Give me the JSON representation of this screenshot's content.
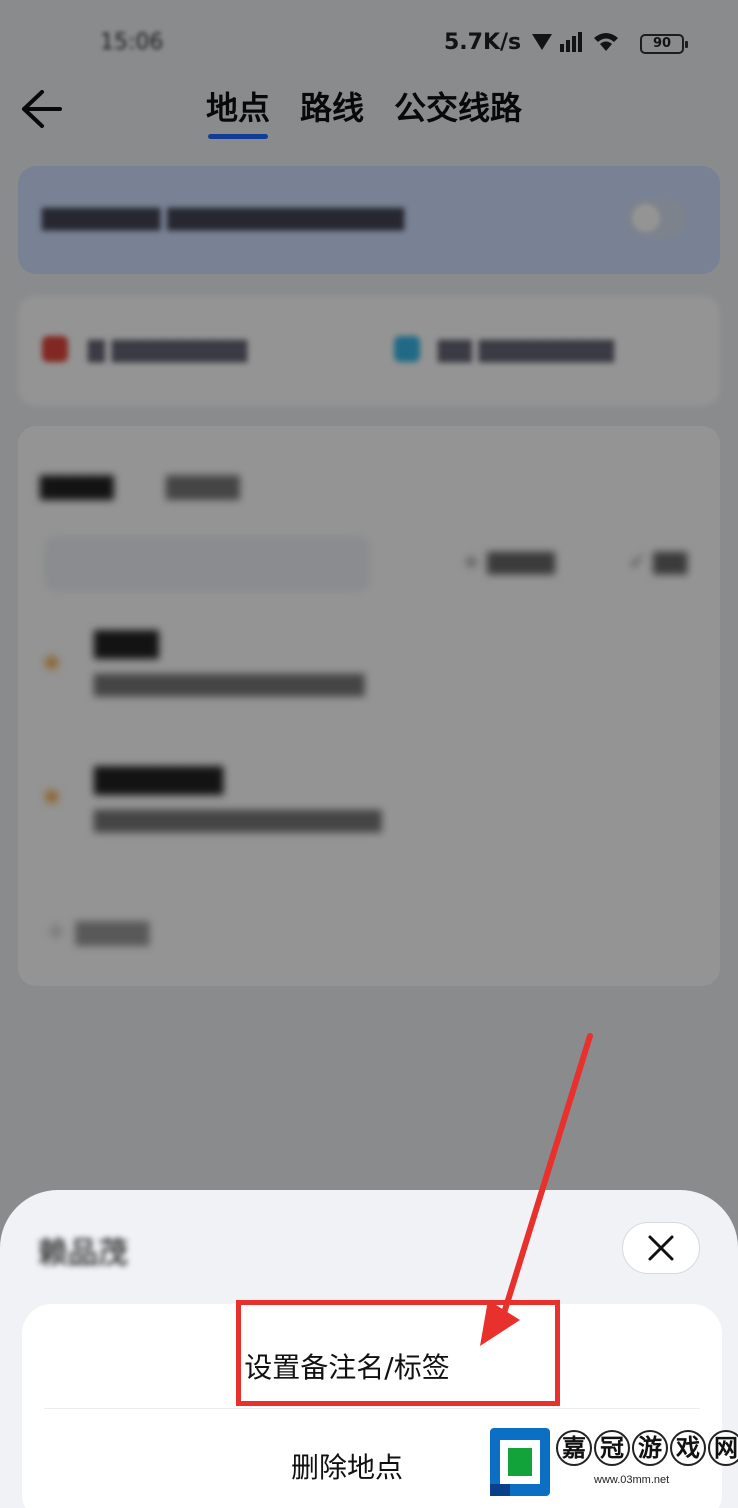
{
  "status_bar": {
    "time": "15:06",
    "net_speed": "5.7K/s",
    "battery": "90"
  },
  "header": {
    "tabs": [
      {
        "label": "地点",
        "active": true
      },
      {
        "label": "路线",
        "active": false
      },
      {
        "label": "公交线路",
        "active": false
      }
    ]
  },
  "sheet": {
    "title": "赖品茂",
    "options": [
      {
        "label": "设置备注名/标签"
      },
      {
        "label": "删除地点"
      }
    ]
  },
  "annotation": {
    "color": "#e8302c"
  },
  "watermark": {
    "chars": [
      "嘉",
      "冠",
      "游",
      "戏",
      "网"
    ],
    "url": "www.03mm.net"
  }
}
